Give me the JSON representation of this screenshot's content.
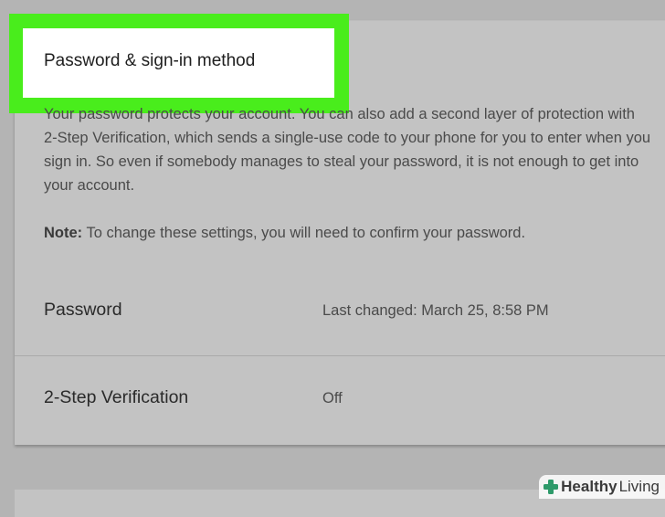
{
  "section": {
    "title": "Password & sign-in method",
    "description": "Your password protects your account. You can also add a second layer of protection with 2-Step Verification, which sends a single-use code to your phone for you to enter when you sign in. So even if somebody manages to steal your password, it is not enough to get into your account.",
    "note_label": "Note:",
    "note_text": " To change these settings, you will need to confirm your password."
  },
  "rows": [
    {
      "label": "Password",
      "value": "Last changed: March 25, 8:58 PM"
    },
    {
      "label": "2-Step Verification",
      "value": "Off"
    }
  ],
  "watermark": {
    "part1": "Healthy",
    "part2": "Living"
  },
  "colors": {
    "highlight": "#49ed1c",
    "background": "#b4b4b4",
    "card": "#c3c3c3",
    "watermark_green": "#2e9a6a"
  }
}
